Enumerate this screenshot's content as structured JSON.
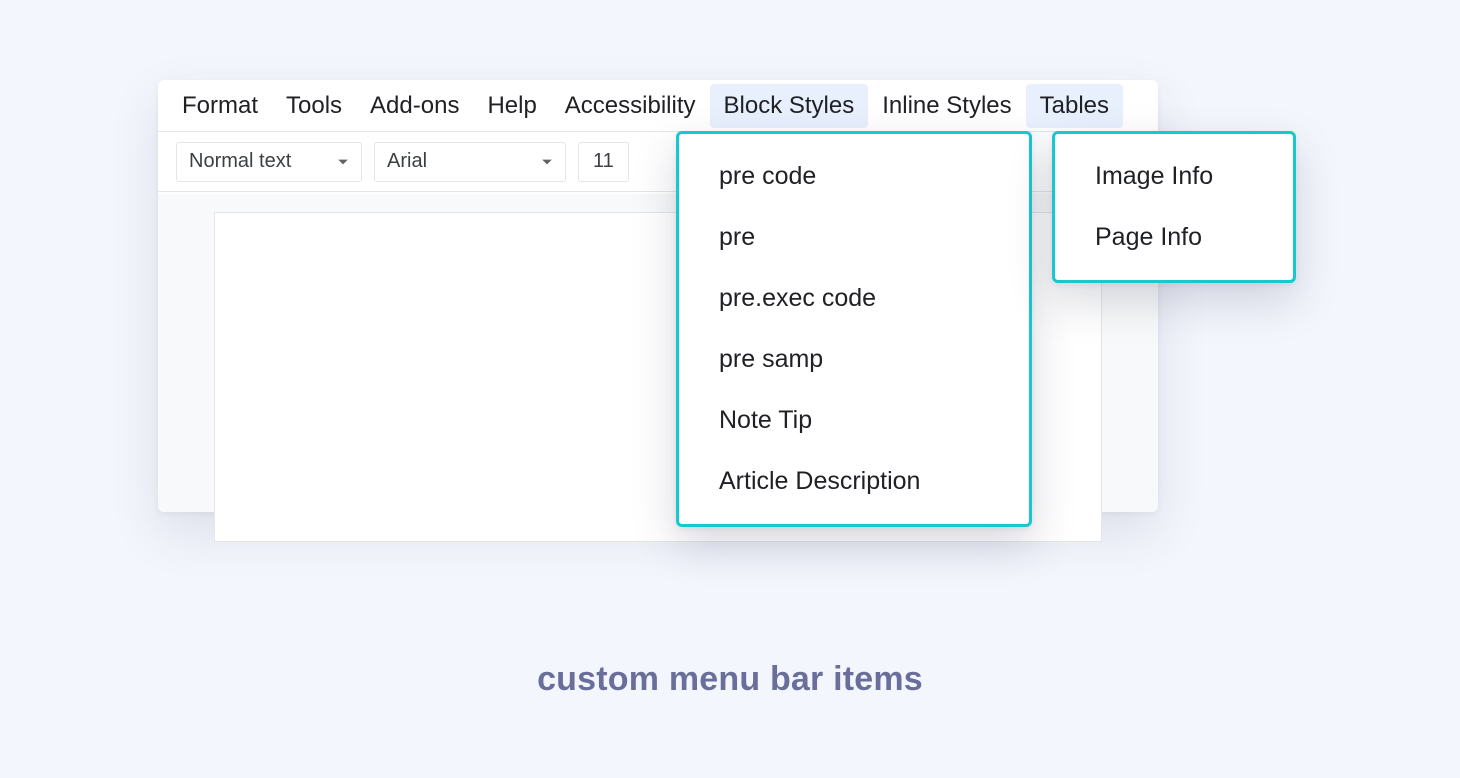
{
  "menubar": {
    "items": [
      {
        "label": "Format",
        "highlight": false
      },
      {
        "label": "Tools",
        "highlight": false
      },
      {
        "label": "Add-ons",
        "highlight": false
      },
      {
        "label": "Help",
        "highlight": false
      },
      {
        "label": "Accessibility",
        "highlight": false
      },
      {
        "label": "Block Styles",
        "highlight": true
      },
      {
        "label": "Inline Styles",
        "highlight": false
      },
      {
        "label": "Tables",
        "highlight": true
      }
    ]
  },
  "toolbar": {
    "text_style": "Normal text",
    "font_family": "Arial",
    "font_size": "11"
  },
  "dropdowns": {
    "block_styles": {
      "items": [
        "pre code",
        "pre",
        "pre.exec code",
        "pre samp",
        "Note Tip",
        "Article Description"
      ]
    },
    "tables": {
      "items": [
        "Image Info",
        "Page Info"
      ]
    }
  },
  "caption": "custom menu bar items",
  "colors": {
    "accent_teal": "#18c7cf",
    "menu_highlight": "#e8f0fe",
    "caption_text": "#6a6e9b",
    "page_bg": "#f4f6fd"
  }
}
